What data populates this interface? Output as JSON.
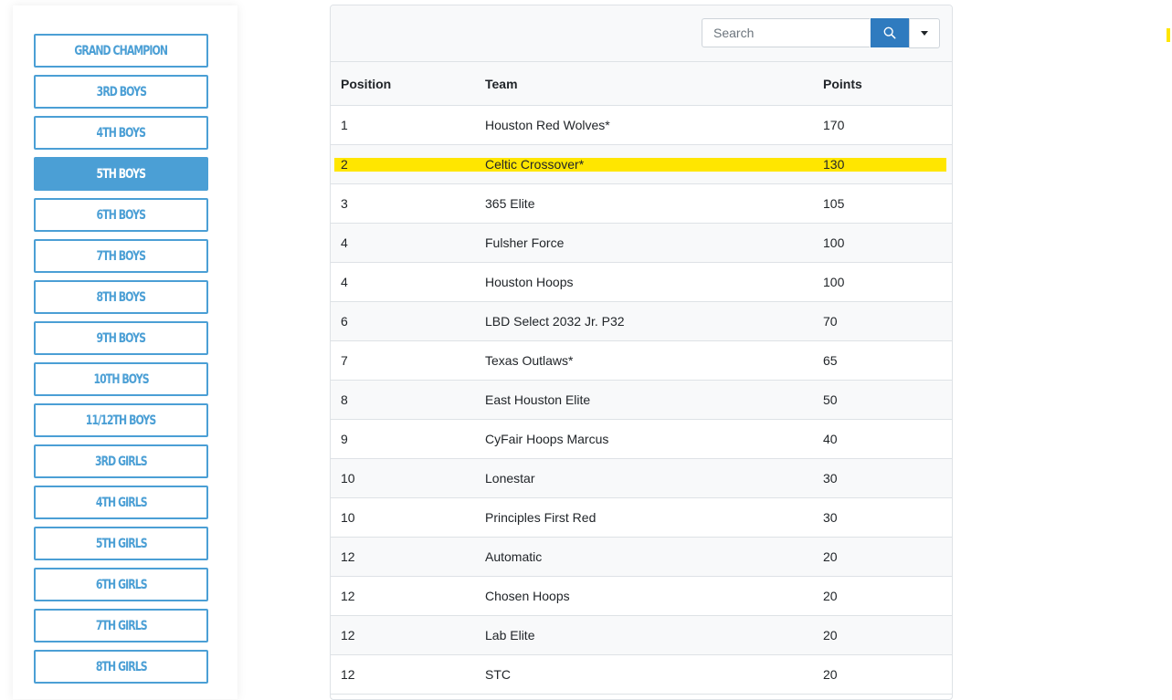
{
  "sidebar": {
    "categories": [
      {
        "label": "GRAND CHAMPION",
        "active": false
      },
      {
        "label": "3RD BOYS",
        "active": false
      },
      {
        "label": "4TH BOYS",
        "active": false
      },
      {
        "label": "5TH BOYS",
        "active": true
      },
      {
        "label": "6TH BOYS",
        "active": false
      },
      {
        "label": "7TH BOYS",
        "active": false
      },
      {
        "label": "8TH BOYS",
        "active": false
      },
      {
        "label": "9TH BOYS",
        "active": false
      },
      {
        "label": "10TH BOYS",
        "active": false
      },
      {
        "label": "11/12TH BOYS",
        "active": false
      },
      {
        "label": "3RD GIRLS",
        "active": false
      },
      {
        "label": "4TH GIRLS",
        "active": false
      },
      {
        "label": "5TH GIRLS",
        "active": false
      },
      {
        "label": "6TH GIRLS",
        "active": false
      },
      {
        "label": "7TH GIRLS",
        "active": false
      },
      {
        "label": "8TH GIRLS",
        "active": false
      }
    ]
  },
  "toolbar": {
    "search_placeholder": "Search",
    "search_value": "",
    "search_icon": "search-icon",
    "dropdown_icon": "caret-down-icon"
  },
  "table": {
    "headers": {
      "position": "Position",
      "team": "Team",
      "points": "Points"
    },
    "rows": [
      {
        "position": "1",
        "team": "Houston Red Wolves*",
        "points": "170",
        "highlight": false
      },
      {
        "position": "2",
        "team": "Celtic Crossover*",
        "points": "130",
        "highlight": true
      },
      {
        "position": "3",
        "team": "365 Elite",
        "points": "105",
        "highlight": false
      },
      {
        "position": "4",
        "team": "Fulsher Force",
        "points": "100",
        "highlight": false
      },
      {
        "position": "4",
        "team": "Houston Hoops",
        "points": "100",
        "highlight": false
      },
      {
        "position": "6",
        "team": "LBD Select 2032 Jr. P32",
        "points": "70",
        "highlight": false
      },
      {
        "position": "7",
        "team": "Texas Outlaws*",
        "points": "65",
        "highlight": false
      },
      {
        "position": "8",
        "team": "East Houston Elite",
        "points": "50",
        "highlight": false
      },
      {
        "position": "9",
        "team": "CyFair Hoops Marcus",
        "points": "40",
        "highlight": false
      },
      {
        "position": "10",
        "team": "Lonestar",
        "points": "30",
        "highlight": false
      },
      {
        "position": "10",
        "team": "Principles First Red",
        "points": "30",
        "highlight": false
      },
      {
        "position": "12",
        "team": "Automatic",
        "points": "20",
        "highlight": false
      },
      {
        "position": "12",
        "team": "Chosen Hoops",
        "points": "20",
        "highlight": false
      },
      {
        "position": "12",
        "team": "Lab Elite",
        "points": "20",
        "highlight": false
      },
      {
        "position": "12",
        "team": "STC",
        "points": "20",
        "highlight": false
      }
    ]
  },
  "colors": {
    "accent": "#4b9fd5",
    "search_button": "#2f7bbf",
    "highlight": "#ffe600"
  }
}
